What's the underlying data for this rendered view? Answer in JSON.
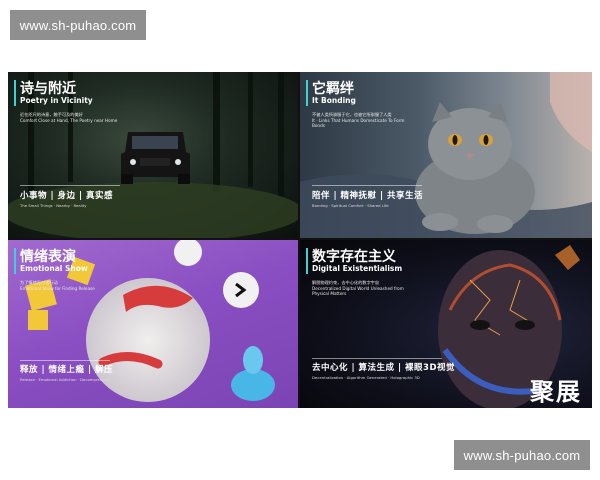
{
  "watermark": {
    "top_text": "www.sh-puhao.com",
    "bottom_text": "www.sh-puhao.com"
  },
  "panels": [
    {
      "title_zh": "诗与附近",
      "title_en": "Poetry in Vicinity",
      "desc": "近在咫尺的诗意，触手可及的美好\nComfort Close at Hand, The Poetry near Home",
      "tags": "小事物 | 身边 | 真实感",
      "tags_en": "The Small Things · Nearby · Reality"
    },
    {
      "title_zh": "它羁绊",
      "title_en": "It Bonding",
      "desc": "不被人类所驯服于它，也被它所驯服了人类\nIt · Links That Humans Domesticate To Form Bonds",
      "tags": "陪伴 | 精神抚慰 | 共享生活",
      "tags_en": "Bonding · Spiritual Comfort · Shared Life"
    },
    {
      "title_zh": "情绪表演",
      "title_en": "Emotional Show",
      "desc": "为了情绪而付诸行动\nEmotional Show for Finding Release",
      "tags": "释放 | 情绪上瘾 | 解压",
      "tags_en": "Release · Emotional Addiction · Decompression"
    },
    {
      "title_zh": "数字存在主义",
      "title_en": "Digital Existentialism",
      "desc": "解脱物理约束，去中心化的数字宇宙\nDecentralized Digital World Unleashed from Physical Matters",
      "tags": "去中心化 | 算法生成 | 裸眼3D视觉",
      "tags_en": "Decentralization · Algorithm Generated · Holographic 3D"
    }
  ],
  "brand_logo": "聚展"
}
